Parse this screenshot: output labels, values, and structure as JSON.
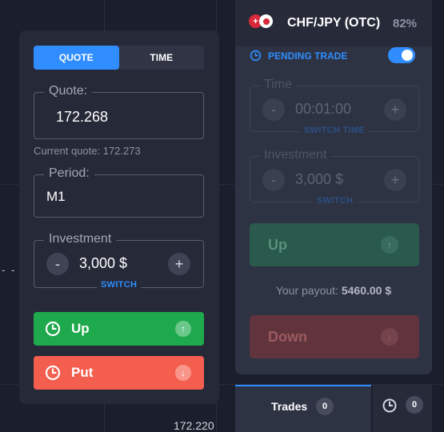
{
  "left_panel": {
    "tabs": [
      {
        "label": "QUOTE",
        "active": true
      },
      {
        "label": "TIME",
        "active": false
      }
    ],
    "quote": {
      "legend": "Quote:",
      "value": "172.268"
    },
    "current_quote": "Current quote: 172.273",
    "period": {
      "legend": "Period:",
      "value": "M1"
    },
    "investment": {
      "legend": "Investment",
      "value": "3,000 $",
      "minus": "-",
      "plus": "+",
      "switch_label": "SWITCH"
    },
    "up_button": {
      "label": "Up",
      "arrow": "↑"
    },
    "put_button": {
      "label": "Put",
      "arrow": "↓"
    }
  },
  "right_panel": {
    "pair": {
      "name": "CHF/JPY (OTC)",
      "payout": "82%",
      "flag_symbol": "+"
    },
    "pending_trade": {
      "label": "PENDING TRADE",
      "enabled": true
    },
    "time": {
      "legend": "Time",
      "value": "00:01:00",
      "minus": "-",
      "plus": "+",
      "switch_label": "SWITCH TIME"
    },
    "investment": {
      "legend": "Investment",
      "value": "3,000 $",
      "minus": "-",
      "plus": "+",
      "switch_label": "SWITCH"
    },
    "up_button": {
      "label": "Up",
      "arrow": "↑"
    },
    "payout_prefix": "Your payout:",
    "payout_value": "5460.00 $",
    "down_button": {
      "label": "Down",
      "arrow": "↓"
    }
  },
  "bottom_tabs": {
    "trades": {
      "label": "Trades",
      "count": "0"
    },
    "pending": {
      "count": "0"
    }
  },
  "chart": {
    "price_label": "172.220",
    "dash_mark": "- -"
  },
  "colors": {
    "accent": "#2f8dff",
    "up": "#1ea94c",
    "put": "#f45e4f",
    "panel": "#262938"
  }
}
